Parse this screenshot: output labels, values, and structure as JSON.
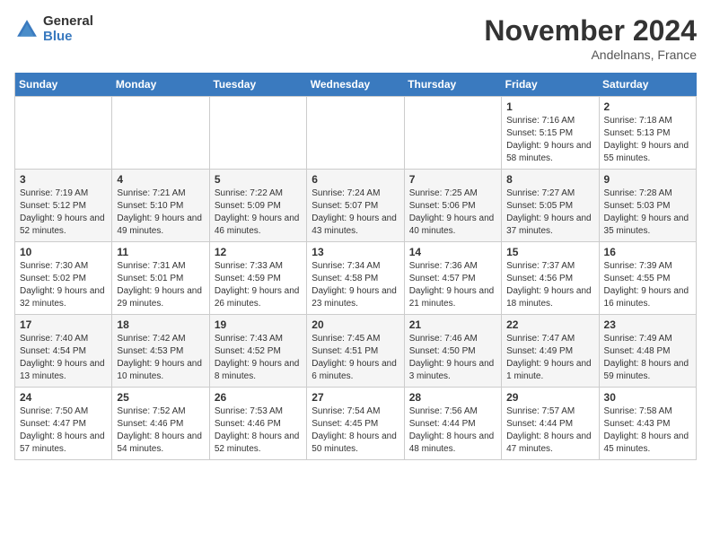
{
  "logo": {
    "general": "General",
    "blue": "Blue"
  },
  "header": {
    "month": "November 2024",
    "location": "Andelnans, France"
  },
  "weekdays": [
    "Sunday",
    "Monday",
    "Tuesday",
    "Wednesday",
    "Thursday",
    "Friday",
    "Saturday"
  ],
  "weeks": [
    [
      {
        "day": "",
        "info": ""
      },
      {
        "day": "",
        "info": ""
      },
      {
        "day": "",
        "info": ""
      },
      {
        "day": "",
        "info": ""
      },
      {
        "day": "",
        "info": ""
      },
      {
        "day": "1",
        "info": "Sunrise: 7:16 AM\nSunset: 5:15 PM\nDaylight: 9 hours and 58 minutes."
      },
      {
        "day": "2",
        "info": "Sunrise: 7:18 AM\nSunset: 5:13 PM\nDaylight: 9 hours and 55 minutes."
      }
    ],
    [
      {
        "day": "3",
        "info": "Sunrise: 7:19 AM\nSunset: 5:12 PM\nDaylight: 9 hours and 52 minutes."
      },
      {
        "day": "4",
        "info": "Sunrise: 7:21 AM\nSunset: 5:10 PM\nDaylight: 9 hours and 49 minutes."
      },
      {
        "day": "5",
        "info": "Sunrise: 7:22 AM\nSunset: 5:09 PM\nDaylight: 9 hours and 46 minutes."
      },
      {
        "day": "6",
        "info": "Sunrise: 7:24 AM\nSunset: 5:07 PM\nDaylight: 9 hours and 43 minutes."
      },
      {
        "day": "7",
        "info": "Sunrise: 7:25 AM\nSunset: 5:06 PM\nDaylight: 9 hours and 40 minutes."
      },
      {
        "day": "8",
        "info": "Sunrise: 7:27 AM\nSunset: 5:05 PM\nDaylight: 9 hours and 37 minutes."
      },
      {
        "day": "9",
        "info": "Sunrise: 7:28 AM\nSunset: 5:03 PM\nDaylight: 9 hours and 35 minutes."
      }
    ],
    [
      {
        "day": "10",
        "info": "Sunrise: 7:30 AM\nSunset: 5:02 PM\nDaylight: 9 hours and 32 minutes."
      },
      {
        "day": "11",
        "info": "Sunrise: 7:31 AM\nSunset: 5:01 PM\nDaylight: 9 hours and 29 minutes."
      },
      {
        "day": "12",
        "info": "Sunrise: 7:33 AM\nSunset: 4:59 PM\nDaylight: 9 hours and 26 minutes."
      },
      {
        "day": "13",
        "info": "Sunrise: 7:34 AM\nSunset: 4:58 PM\nDaylight: 9 hours and 23 minutes."
      },
      {
        "day": "14",
        "info": "Sunrise: 7:36 AM\nSunset: 4:57 PM\nDaylight: 9 hours and 21 minutes."
      },
      {
        "day": "15",
        "info": "Sunrise: 7:37 AM\nSunset: 4:56 PM\nDaylight: 9 hours and 18 minutes."
      },
      {
        "day": "16",
        "info": "Sunrise: 7:39 AM\nSunset: 4:55 PM\nDaylight: 9 hours and 16 minutes."
      }
    ],
    [
      {
        "day": "17",
        "info": "Sunrise: 7:40 AM\nSunset: 4:54 PM\nDaylight: 9 hours and 13 minutes."
      },
      {
        "day": "18",
        "info": "Sunrise: 7:42 AM\nSunset: 4:53 PM\nDaylight: 9 hours and 10 minutes."
      },
      {
        "day": "19",
        "info": "Sunrise: 7:43 AM\nSunset: 4:52 PM\nDaylight: 9 hours and 8 minutes."
      },
      {
        "day": "20",
        "info": "Sunrise: 7:45 AM\nSunset: 4:51 PM\nDaylight: 9 hours and 6 minutes."
      },
      {
        "day": "21",
        "info": "Sunrise: 7:46 AM\nSunset: 4:50 PM\nDaylight: 9 hours and 3 minutes."
      },
      {
        "day": "22",
        "info": "Sunrise: 7:47 AM\nSunset: 4:49 PM\nDaylight: 9 hours and 1 minute."
      },
      {
        "day": "23",
        "info": "Sunrise: 7:49 AM\nSunset: 4:48 PM\nDaylight: 8 hours and 59 minutes."
      }
    ],
    [
      {
        "day": "24",
        "info": "Sunrise: 7:50 AM\nSunset: 4:47 PM\nDaylight: 8 hours and 57 minutes."
      },
      {
        "day": "25",
        "info": "Sunrise: 7:52 AM\nSunset: 4:46 PM\nDaylight: 8 hours and 54 minutes."
      },
      {
        "day": "26",
        "info": "Sunrise: 7:53 AM\nSunset: 4:46 PM\nDaylight: 8 hours and 52 minutes."
      },
      {
        "day": "27",
        "info": "Sunrise: 7:54 AM\nSunset: 4:45 PM\nDaylight: 8 hours and 50 minutes."
      },
      {
        "day": "28",
        "info": "Sunrise: 7:56 AM\nSunset: 4:44 PM\nDaylight: 8 hours and 48 minutes."
      },
      {
        "day": "29",
        "info": "Sunrise: 7:57 AM\nSunset: 4:44 PM\nDaylight: 8 hours and 47 minutes."
      },
      {
        "day": "30",
        "info": "Sunrise: 7:58 AM\nSunset: 4:43 PM\nDaylight: 8 hours and 45 minutes."
      }
    ]
  ]
}
